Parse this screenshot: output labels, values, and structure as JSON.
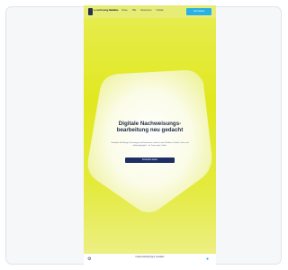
{
  "site": {
    "logo_text": "e-rechnung service"
  },
  "nav": {
    "links": [
      "Produkte",
      "Preise",
      "Hilfe",
      "Ressourcen",
      "Kontakt"
    ],
    "cta_label": "Jetzt starten"
  },
  "hero": {
    "headline": "Digitale Nachweisungs-bearbeitung neu gedacht",
    "subtext": "Verwalten Sie Belege, Rechnungen und Nachweise zentral in einer Plattform. Schnell, sicher und vollständig digital – für Teams jeder Größe.",
    "cta_label": "Kostenlos testen"
  },
  "footer": {
    "text": "Cookie-Einstellungen verwalten"
  },
  "colors": {
    "accent": "#27b1e6",
    "navy": "#1f2f66",
    "hero_yellow": "#e1e820"
  },
  "icons": {
    "footer_left": "settings-icon",
    "footer_right": "chat-icon"
  }
}
